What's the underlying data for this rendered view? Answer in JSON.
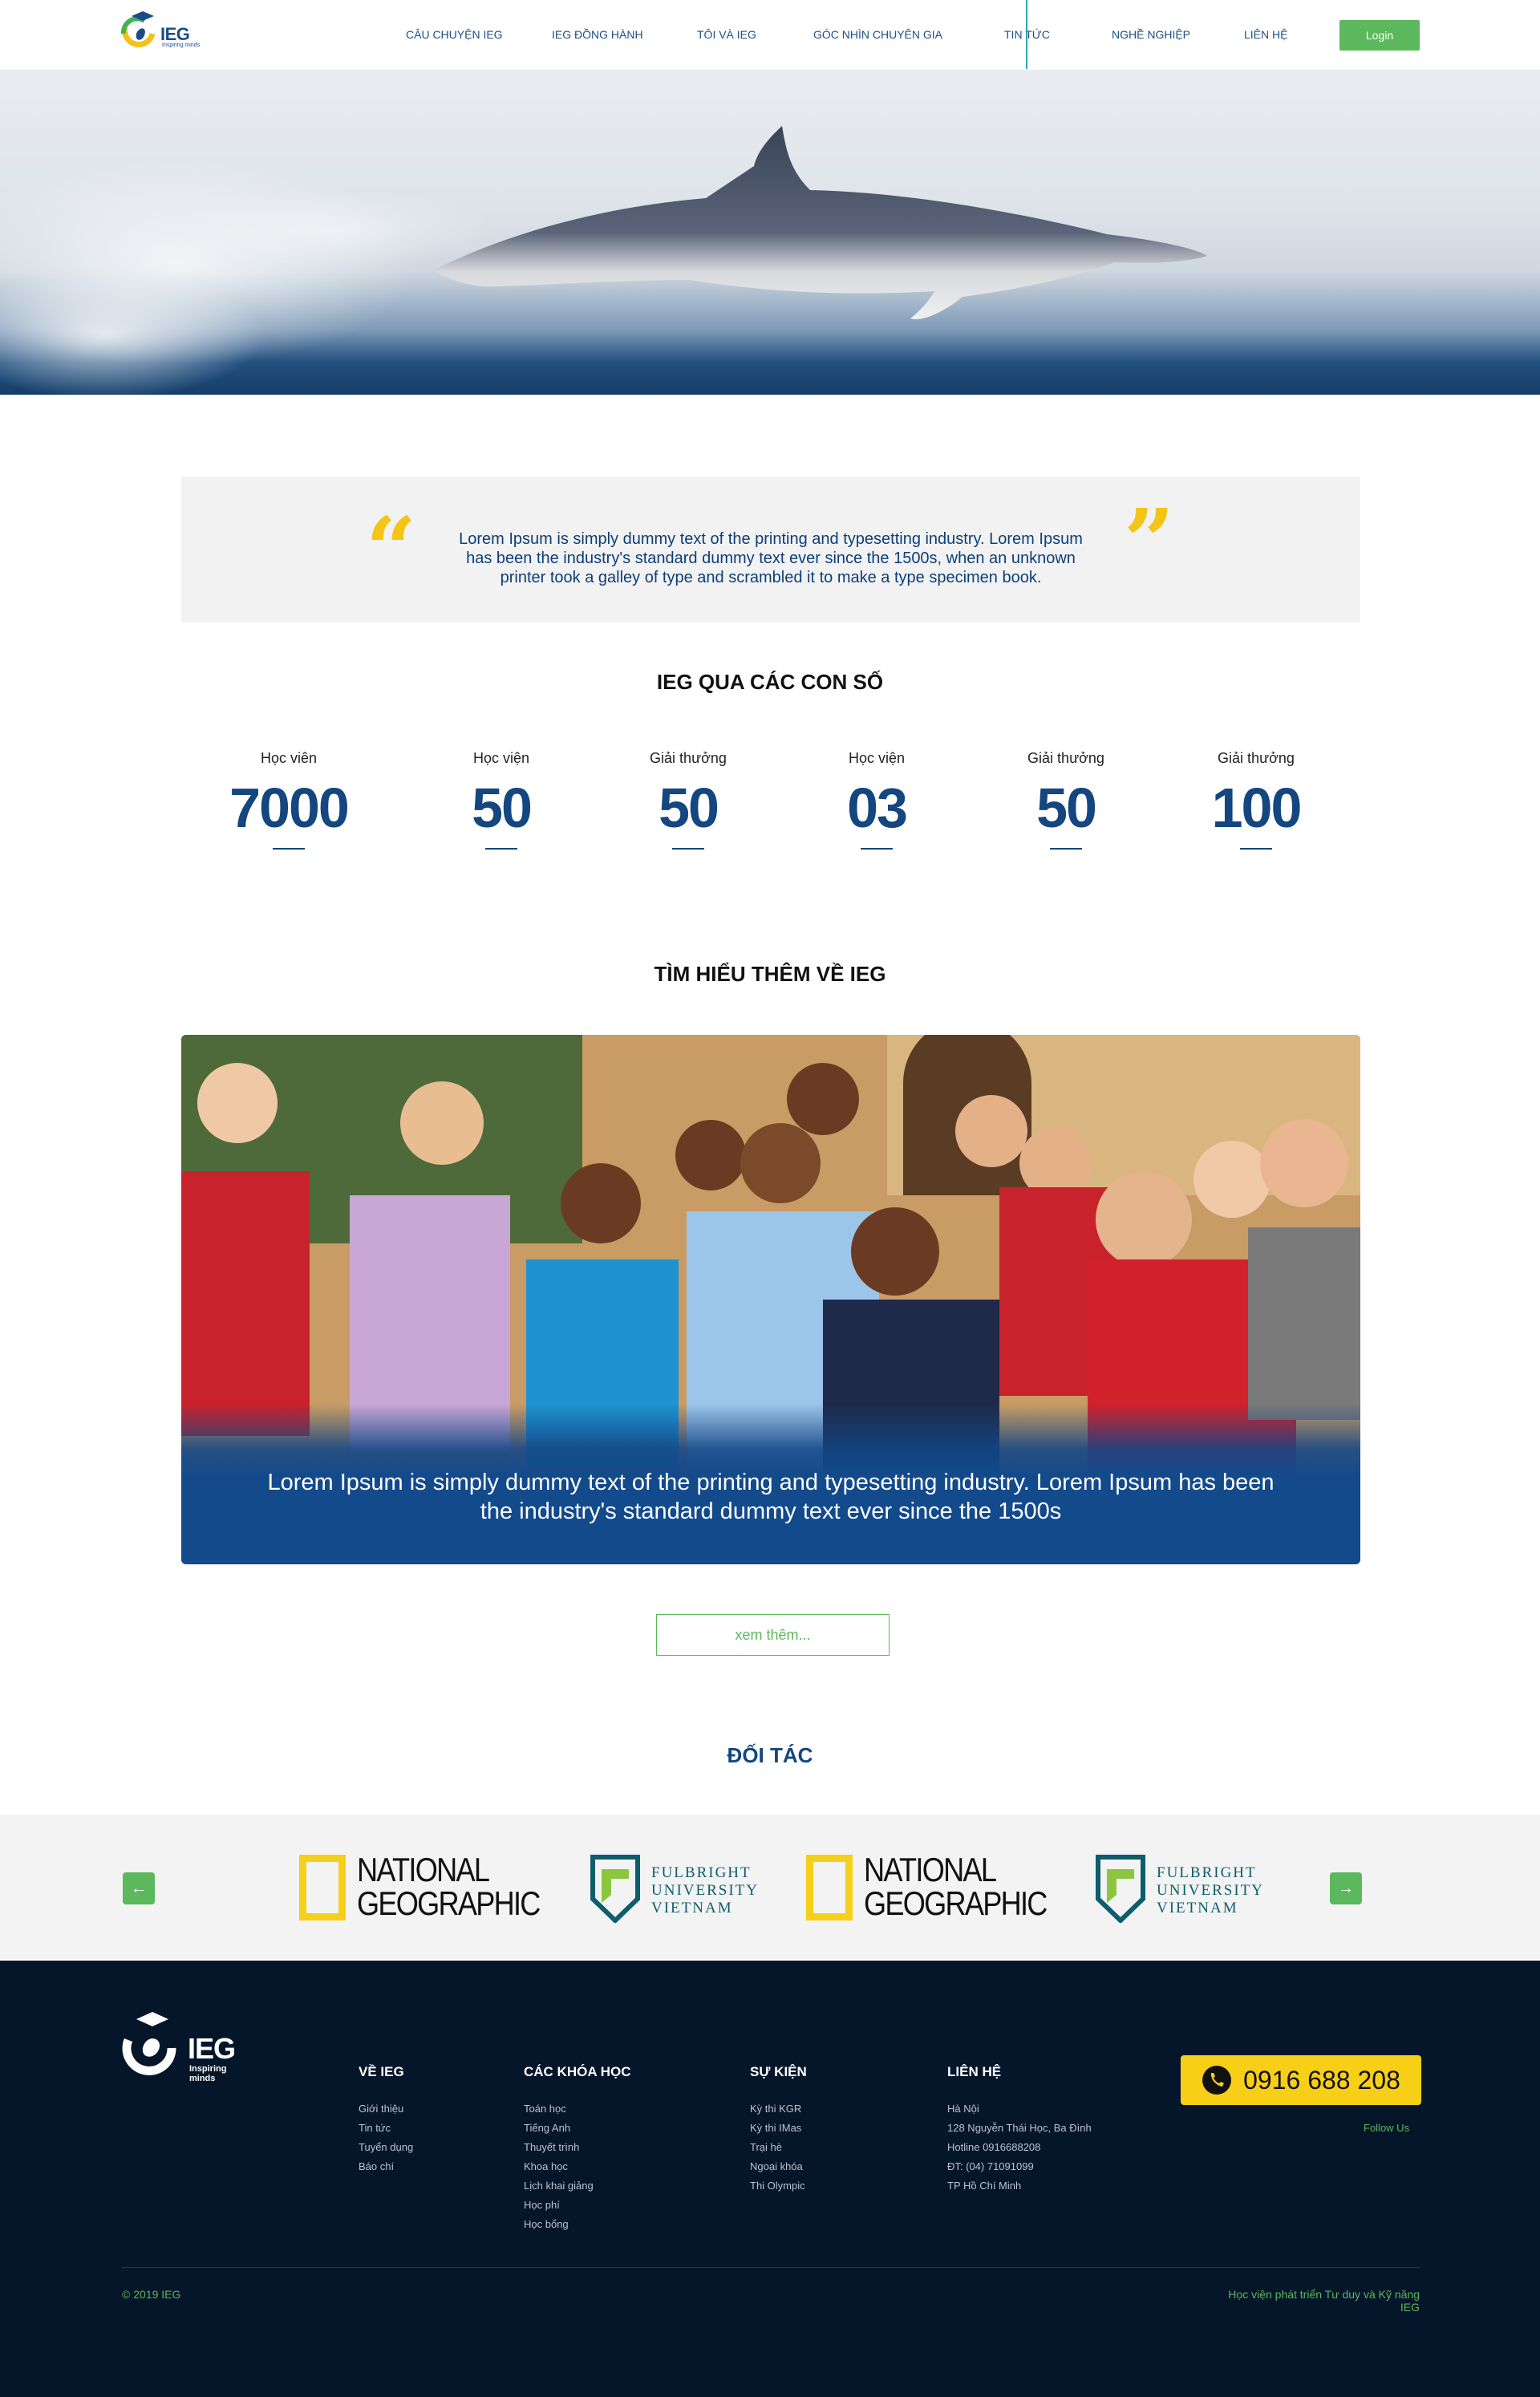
{
  "header": {
    "logo_text": "IEG",
    "logo_tagline": "Inspiring minds",
    "nav": [
      "CÂU CHUYỆN IEG",
      "IEG ĐỒNG HÀNH",
      "TÔI VÀ IEG",
      "GÓC NHÌN CHUYÊN GIA",
      "TIN TỨC",
      "NGHỀ NGHIỆP",
      "LIÊN HỆ"
    ],
    "active_nav": "TIN TỨC",
    "login_label": "Login"
  },
  "quote": {
    "text": "Lorem Ipsum is simply dummy text of the printing and typesetting industry. Lorem Ipsum has been the industry's standard dummy text ever since the 1500s, when an unknown printer took a galley of type and scrambled it to make a type specimen book."
  },
  "stats": {
    "title": "IEG QUA CÁC CON SỐ",
    "items": [
      {
        "label": "Học viên",
        "value": "7000"
      },
      {
        "label": "Học viện",
        "value": "50"
      },
      {
        "label": "Giải thưởng",
        "value": "50"
      },
      {
        "label": "Học viện",
        "value": "03"
      },
      {
        "label": "Giải thưởng",
        "value": "50"
      },
      {
        "label": "Giải thưởng",
        "value": "100"
      }
    ]
  },
  "about": {
    "title": "TÌM HIỂU THÊM VỀ IEG",
    "caption": "Lorem Ipsum is simply dummy text of the printing and typesetting industry. Lorem Ipsum has been the industry's standard dummy text ever since the 1500s",
    "more_label": "xem thêm..."
  },
  "partners": {
    "title": "ĐỐI TÁC",
    "logos": [
      {
        "line1": "NATIONAL",
        "line2": "GEOGRAPHIC"
      },
      {
        "line1": "FULBRIGHT",
        "line2": "UNIVERSITY",
        "line3": "VIETNAM"
      },
      {
        "line1": "NATIONAL",
        "line2": "GEOGRAPHIC"
      },
      {
        "line1": "FULBRIGHT",
        "line2": "UNIVERSITY",
        "line3": "VIETNAM"
      }
    ]
  },
  "footer": {
    "logo_text": "IEG",
    "logo_tagline": "Inspiring minds",
    "columns": [
      {
        "title": "VỀ IEG",
        "links": [
          "Giới thiệu",
          "Tin tức",
          "Tuyển dụng",
          "Báo chí"
        ]
      },
      {
        "title": "CÁC KHÓA HỌC",
        "links": [
          "Toán học",
          "Tiếng Anh",
          "Thuyết trình",
          "Khoa học",
          "Lịch khai giảng",
          "Học phí",
          "Học bổng"
        ]
      },
      {
        "title": "SỰ KIỆN",
        "links": [
          "Kỳ thi KGR",
          "Kỳ thi IMas",
          "Trại hè",
          "Ngoại khóa",
          "Thi Olympic"
        ]
      },
      {
        "title": "LIÊN HỆ",
        "links": [
          "Hà Nội",
          "128 Nguyễn Thái Học, Ba Đình",
          "Hotline 0916688208",
          "ĐT: (04) 71091099",
          "TP Hồ Chí Minh"
        ]
      }
    ],
    "phone": "0916 688 208",
    "follow": "Follow Us",
    "copyright": "© 2019 IEG",
    "slogan": "Học viện phát triển Tư duy và Kỹ năng IEG"
  },
  "colors": {
    "brand_blue": "#14467f",
    "accent_green": "#5cb85c",
    "accent_yellow": "#f4c516",
    "footer_bg": "#06162a"
  }
}
